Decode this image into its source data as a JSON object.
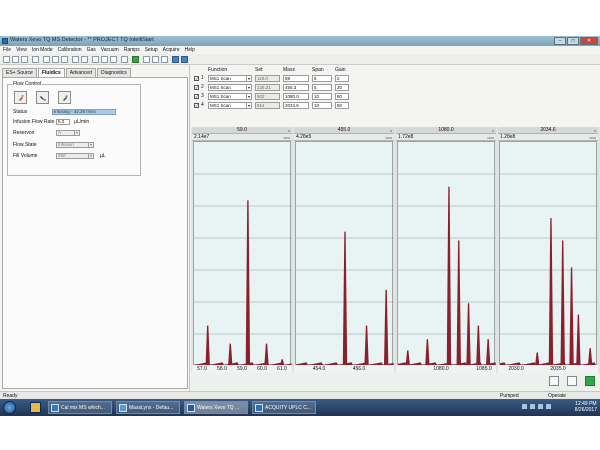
{
  "window": {
    "title": "Waters Xevo TQ MS Detector - ** PROJECT TQ IntelliStart"
  },
  "menu": [
    "File",
    "View",
    "Ion Mode",
    "Calibration",
    "Gas",
    "Vacuum",
    "Ramps",
    "Setup",
    "Acquire",
    "Help"
  ],
  "tabs": [
    "ES+ Source",
    "Fluidics",
    "Advanced",
    "Diagnostics"
  ],
  "active_tab": "Fluidics",
  "flow_control": {
    "legend": "Flow Control",
    "status_label": "Status",
    "status_value": "Infusing - 42.28 mins",
    "infusion_rate_label": "Infusion Flow Rate",
    "infusion_rate_value": "5.0",
    "infusion_rate_unit": "µL/min",
    "reservoir_label": "Reservoir",
    "reservoir_value": "A",
    "flow_state_label": "Flow State",
    "flow_state_value": "Infusion",
    "fill_volume_label": "Fill Volume",
    "fill_volume_value": "250",
    "fill_volume_unit": "µL"
  },
  "functions": {
    "headers": {
      "function": "Function",
      "set": "Set",
      "mass": "Mass",
      "span": "Span",
      "gain": "Gain"
    },
    "rows": [
      {
        "n": "1",
        "checked": true,
        "function": "MS1 Scan",
        "set": "118.0",
        "mass": "59",
        "span": "5",
        "gain": "2"
      },
      {
        "n": "2",
        "checked": true,
        "function": "MS1 Scan",
        "set": "136.21",
        "mass": "455.3",
        "span": "5",
        "gain": "20"
      },
      {
        "n": "3",
        "checked": true,
        "function": "MS1 Scan",
        "set": "502",
        "mass": "1080.0",
        "span": "10",
        "gain": "80"
      },
      {
        "n": "4",
        "checked": true,
        "function": "MS1 Scan",
        "set": "814",
        "mass": "2034.6",
        "span": "10",
        "gain": "80"
      }
    ]
  },
  "spectra": [
    {
      "center": "59.0",
      "intensity": "2.14e7",
      "ticks": [
        "57.0",
        "58.0",
        "59.0",
        "60.0",
        "61.0"
      ]
    },
    {
      "center": "455.0",
      "intensity": "4.28e5",
      "ticks": [
        "454.0",
        "456.0"
      ]
    },
    {
      "center": "1080.0",
      "intensity": "1.72e8",
      "ticks": [
        "1080.0",
        "1085.0"
      ]
    },
    {
      "center": "2034.6",
      "intensity": "1.28e8",
      "ticks": [
        "2030.0",
        "2035.0"
      ]
    }
  ],
  "status_bar": {
    "left": "Ready",
    "pumped": "Pumped",
    "operate": "Operate"
  },
  "taskbar": {
    "tasks": [
      "Cal mix MS which...",
      "MassLynx - Defau...",
      "Waters Xevo TQ ...",
      "ACQUITY UPLC C..."
    ],
    "time": "12:49 PM",
    "date": "8/26/2017"
  },
  "colors": {
    "peak": "#8b1f2c",
    "plot_bg": "#e8f3f3",
    "status": "#a9cbe8"
  }
}
